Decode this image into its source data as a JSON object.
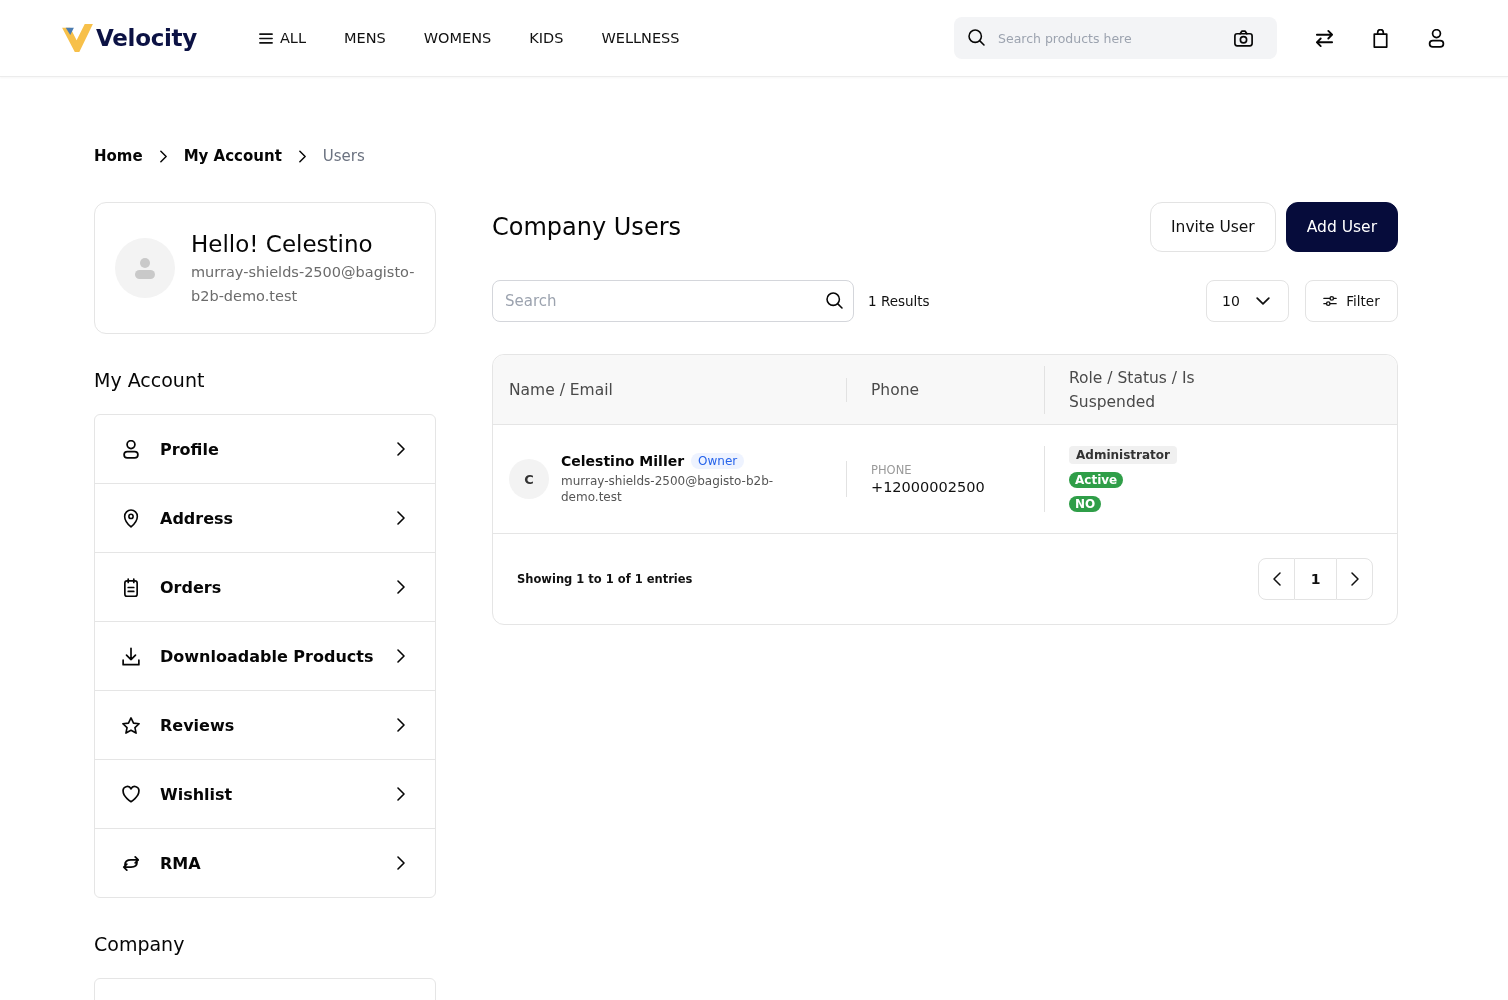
{
  "header": {
    "logo": "Velocity",
    "nav": [
      {
        "label": "ALL",
        "kind": "menu"
      },
      {
        "label": "MENS",
        "kind": "link"
      },
      {
        "label": "WOMENS",
        "kind": "link"
      },
      {
        "label": "KIDS",
        "kind": "link"
      },
      {
        "label": "WELLNESS",
        "kind": "link"
      }
    ],
    "search": {
      "placeholder": "Search products here"
    }
  },
  "breadcrumb": [
    {
      "label": "Home",
      "current": false
    },
    {
      "label": "My Account",
      "current": false
    },
    {
      "label": "Users",
      "current": true
    }
  ],
  "profile": {
    "greeting": "Hello! Celestino",
    "email": "murray-shields-2500@bagisto-b2b-demo.test"
  },
  "sidebar": {
    "sections": [
      {
        "title": "My Account",
        "items": [
          {
            "label": "Profile"
          },
          {
            "label": "Address"
          },
          {
            "label": "Orders"
          },
          {
            "label": "Downloadable Products"
          },
          {
            "label": "Reviews"
          },
          {
            "label": "Wishlist"
          },
          {
            "label": "RMA"
          }
        ]
      },
      {
        "title": "Company"
      }
    ]
  },
  "page": {
    "title": "Company Users",
    "actions": [
      {
        "label": "Invite User",
        "kind": "secondary"
      },
      {
        "label": "Add User",
        "kind": "primary"
      }
    ]
  },
  "toolbar": {
    "search": {
      "placeholder": "Search"
    },
    "results": "1 Results",
    "per_page": "10",
    "filter": "Filter"
  },
  "table": {
    "columns": [
      "Name / Email",
      "Phone",
      "Role / Status / Is Suspended"
    ],
    "rows": [
      {
        "initial": "C",
        "name": "Celestino Miller",
        "badge": "Owner",
        "email": "murray-shields-2500@bagisto-b2b-demo.test",
        "phone_label": "PHONE",
        "phone": "+12000002500",
        "role": "Administrator",
        "status": "Active",
        "suspended": "NO"
      }
    ]
  },
  "pagination": {
    "summary": "Showing 1 to 1 of 1 entries",
    "page": "1"
  }
}
